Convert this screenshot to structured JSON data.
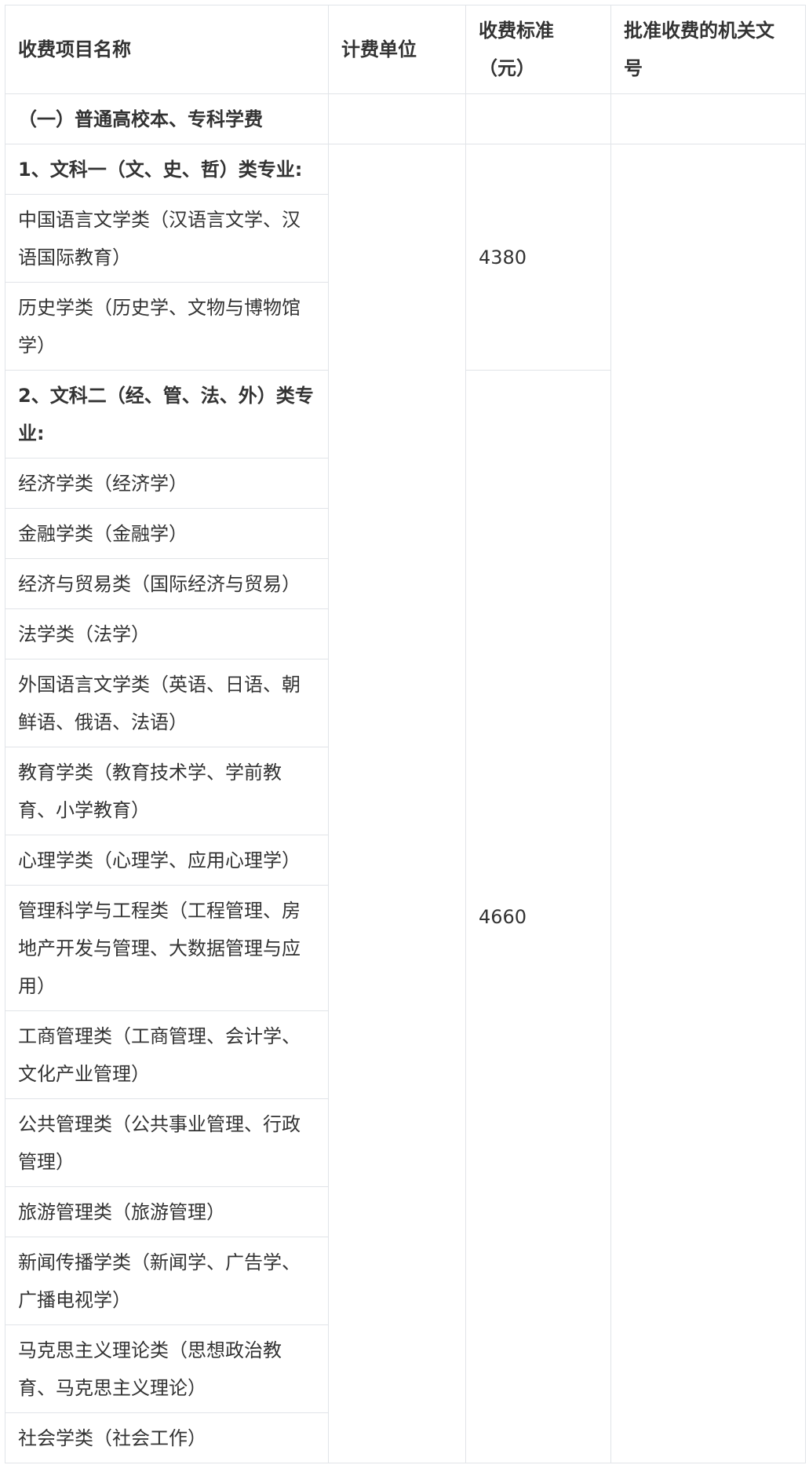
{
  "table": {
    "headers": {
      "name": "收费项目名称",
      "unit": "计费单位",
      "standard_line1": "收费标准",
      "standard_line2": "（元）",
      "authority": "批准收费的机关文号"
    },
    "section_title": "（一）普通高校本、专科学费",
    "groups": [
      {
        "title": "1、文科一（文、史、哲）类专业:",
        "fee": "4380",
        "items": [
          "中国语言文学类（汉语言文学、汉语国际教育）",
          "历史学类（历史学、文物与博物馆学）"
        ]
      },
      {
        "title": "2、文科二（经、管、法、外）类专业:",
        "fee": "4660",
        "items": [
          "经济学类（经济学）",
          "金融学类（金融学）",
          "经济与贸易类（国际经济与贸易）",
          "法学类（法学）",
          "外国语言文学类（英语、日语、朝鲜语、俄语、法语）",
          "教育学类（教育技术学、学前教育、小学教育）",
          "心理学类（心理学、应用心理学）",
          "管理科学与工程类（工程管理、房地产开发与管理、大数据管理与应用）",
          "工商管理类（工商管理、会计学、文化产业管理）",
          "公共管理类（公共事业管理、行政管理）",
          "旅游管理类（旅游管理）",
          "新闻传播学类（新闻学、广告学、广播电视学）",
          "马克思主义理论类（思想政治教育、马克思主义理论）",
          "社会学类（社会工作）"
        ]
      }
    ]
  }
}
